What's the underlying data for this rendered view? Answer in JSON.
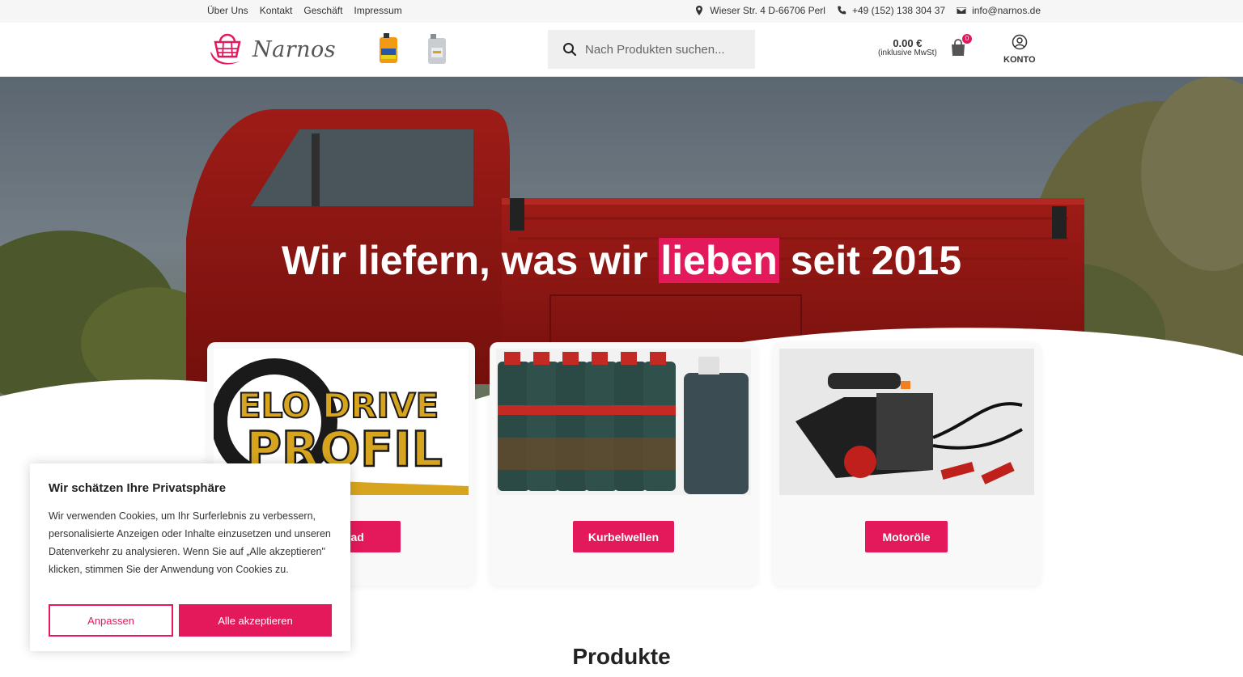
{
  "topbar": {
    "links": [
      "Über Uns",
      "Kontakt",
      "Geschäft",
      "Impressum"
    ],
    "address": "Wieser Str. 4 D-66706 Perl",
    "phone": "+49 (152) 138 304 37",
    "email": "info@narnos.de"
  },
  "header": {
    "logo_text": "Narnos",
    "search_placeholder": "Nach Produkten suchen...",
    "cart_amount": "0.00 €",
    "cart_tax_note": "(inklusive MwSt)",
    "cart_count": "0",
    "account_label": "KONTO"
  },
  "hero": {
    "title_before": "Wir liefern, was wir",
    "title_highlight": "lieben",
    "title_after": "seit 2015"
  },
  "cards": [
    {
      "button_label": "Motorrad",
      "image_text_top": "ELO DRIVE",
      "image_text_bottom": "PROFIL"
    },
    {
      "button_label": "Kurbelwellen"
    },
    {
      "button_label": "Motoröle"
    }
  ],
  "section": {
    "title": "Produkte"
  },
  "cookie": {
    "title": "Wir schätzen Ihre Privatsphäre",
    "text": "Wir verwenden Cookies, um Ihr Surferlebnis zu verbessern, personalisierte Anzeigen oder Inhalte einzusetzen und unseren Datenverkehr zu analysieren. Wenn Sie auf „Alle akzeptieren\" klicken, stimmen Sie der Anwendung von Cookies zu.",
    "customize_label": "Anpassen",
    "accept_label": "Alle akzeptieren"
  },
  "colors": {
    "accent": "#e3195b",
    "topbar_bg": "#f6f6f6",
    "search_bg": "#efefef"
  }
}
